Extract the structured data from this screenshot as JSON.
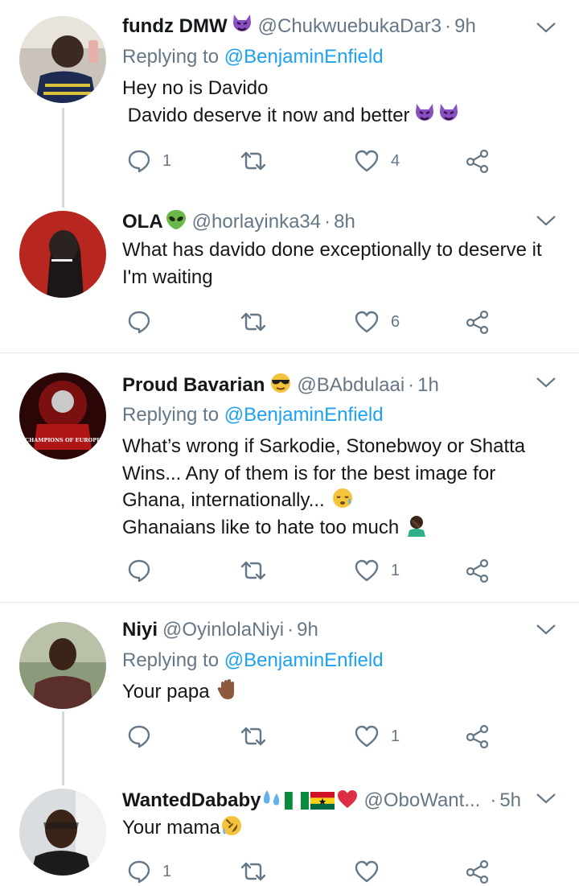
{
  "tweets": [
    {
      "name": "fundz DMW",
      "handle": "@ChukwuebukaDar3",
      "time": "9h",
      "replying_prefix": "Replying to",
      "replying_to": "@BenjaminEnfield",
      "lines": [
        "Hey no is Davido",
        " Davido deserve it now and better"
      ],
      "counts": {
        "reply": "1",
        "retweet": "",
        "like": "4"
      }
    },
    {
      "name": "OLA",
      "handle": "@horlayinka34",
      "time": "8h",
      "lines": [
        "What has davido done exceptionally to deserve it",
        "I'm waiting"
      ],
      "counts": {
        "reply": "",
        "retweet": "",
        "like": "6"
      }
    },
    {
      "name": "Proud Bavarian",
      "handle": "@BAbdulaai",
      "time": "1h",
      "replying_prefix": "Replying to",
      "replying_to": "@BenjaminEnfield",
      "avatar_text": "CHAMPIONS OF EUROPE",
      "lines": [
        "What’s wrong if Sarkodie, Stonebwoy or Shatta",
        "Wins... Any of them is for the best image for",
        "Ghana, internationally...",
        "Ghanaians like to hate too much"
      ],
      "counts": {
        "reply": "",
        "retweet": "",
        "like": "1"
      }
    },
    {
      "name": "Niyi",
      "handle": "@OyinlolaNiyi",
      "time": "9h",
      "replying_prefix": "Replying to",
      "replying_to": "@BenjaminEnfield",
      "lines": [
        "Your papa"
      ],
      "counts": {
        "reply": "",
        "retweet": "",
        "like": "1"
      }
    },
    {
      "name": "WantedDababy",
      "handle": "@OboWant...",
      "time": "5h",
      "lines": [
        "Your mama"
      ],
      "counts": {
        "reply": "1",
        "retweet": "",
        "like": ""
      }
    }
  ],
  "separator": "·",
  "icons": {
    "reply": "reply-icon",
    "retweet": "retweet-icon",
    "like": "like-icon",
    "share": "share-icon",
    "caret": "chevron-down-icon"
  },
  "colors": {
    "text": "#14171a",
    "secondary": "#657786",
    "link": "#1da1f2",
    "divider": "#e1e8ed",
    "thread_line": "#cfd9de"
  }
}
